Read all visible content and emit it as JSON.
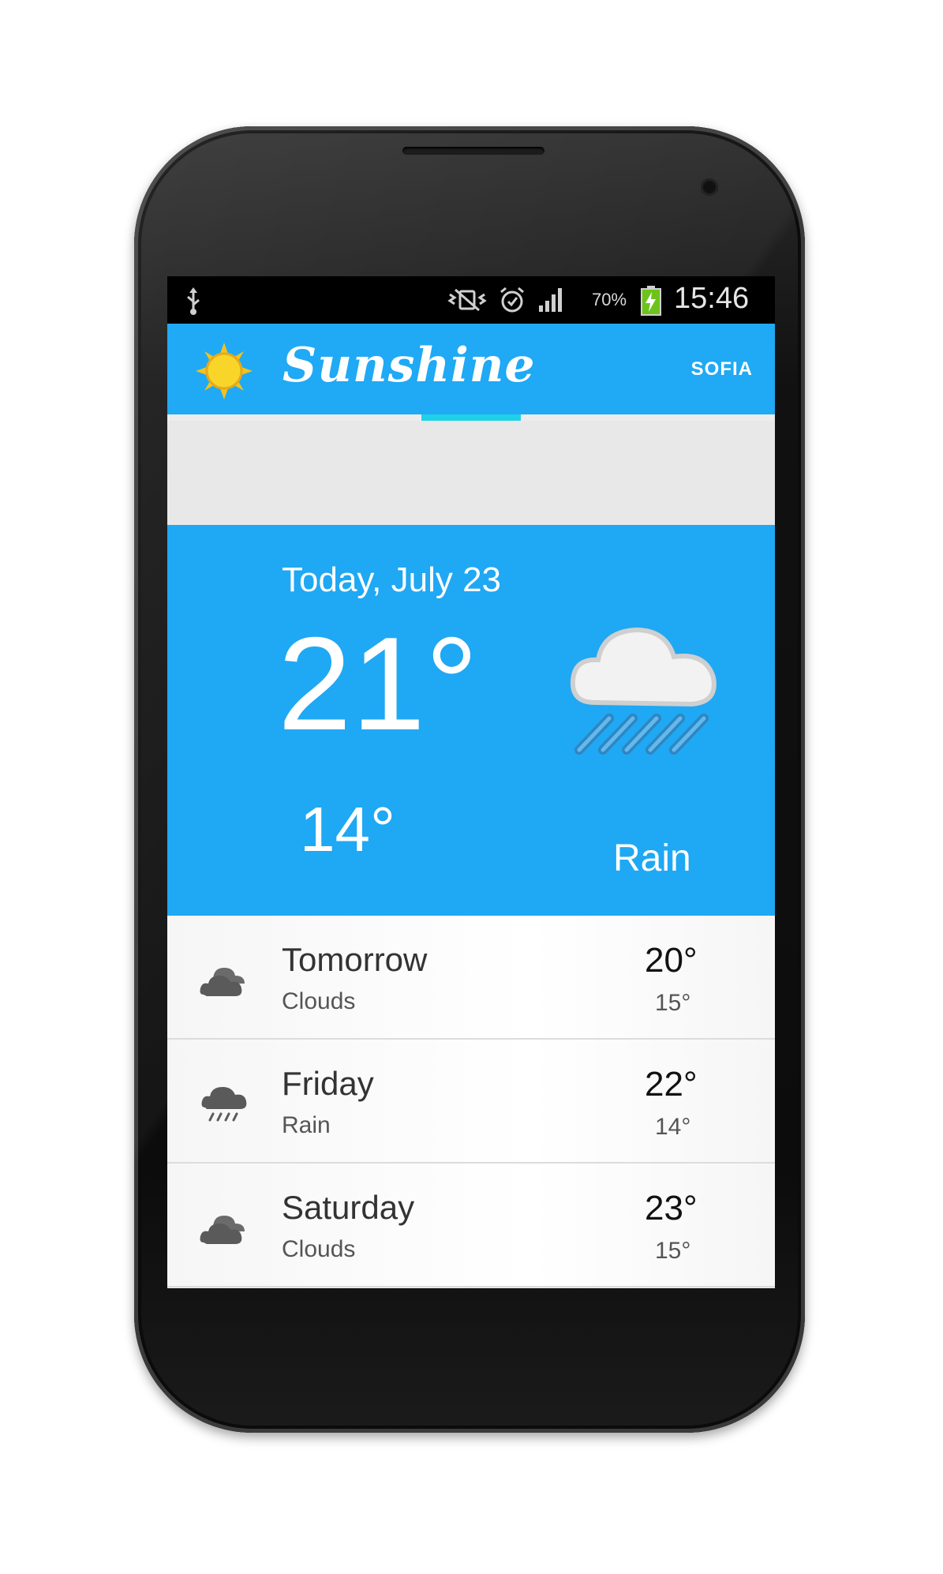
{
  "status_bar": {
    "battery_percent": "70%",
    "time": "15:46"
  },
  "app_bar": {
    "title": "Sunshine",
    "city": "SOFIA"
  },
  "today": {
    "date": "Today, July 23",
    "high": "21°",
    "low": "14°",
    "description": "Rain",
    "icon": "rain-icon"
  },
  "forecast": [
    {
      "day": "Tomorrow",
      "condition": "Clouds",
      "high": "20°",
      "low": "15°",
      "icon": "clouds-icon"
    },
    {
      "day": "Friday",
      "condition": "Rain",
      "high": "22°",
      "low": "14°",
      "icon": "rain-icon"
    },
    {
      "day": "Saturday",
      "condition": "Clouds",
      "high": "23°",
      "low": "15°",
      "icon": "clouds-icon"
    }
  ],
  "colors": {
    "primary": "#20a9f4",
    "tab_indicator": "#1ed1e8",
    "status_bar": "#000000"
  }
}
